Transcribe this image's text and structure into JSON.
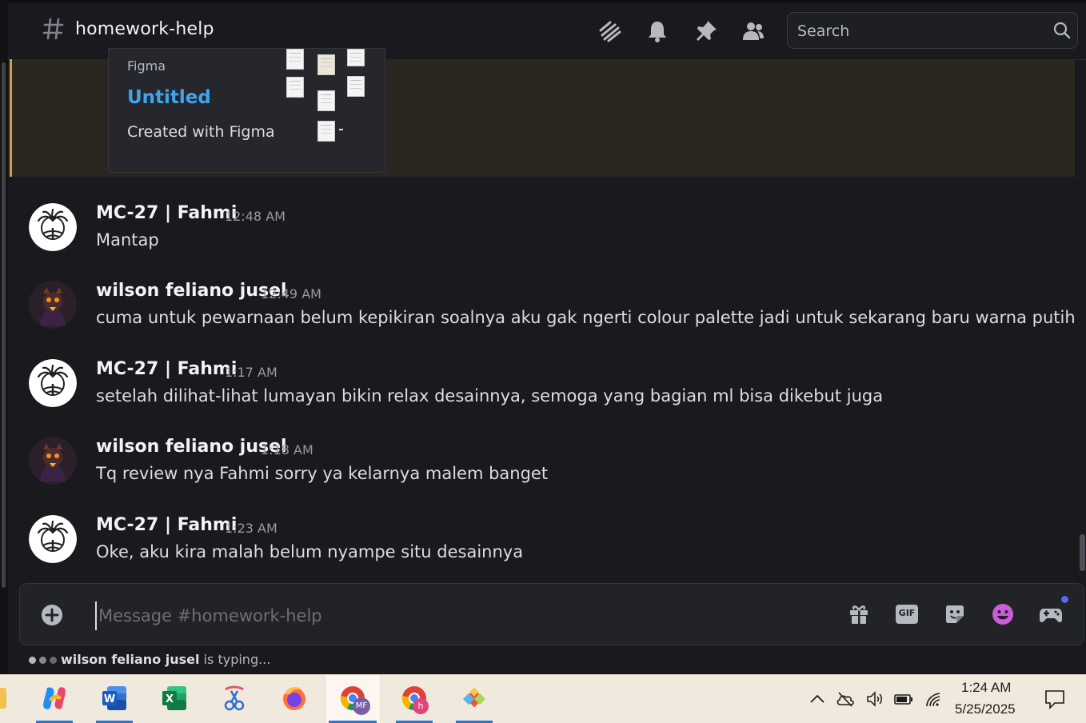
{
  "header": {
    "channel_name": "homework-help",
    "icons": [
      "threads-icon",
      "bell-icon",
      "pin-icon",
      "members-icon"
    ],
    "search_placeholder": "Search"
  },
  "embed": {
    "provider": "Figma",
    "title": "Untitled",
    "description": "Created with Figma",
    "border_color": "#c8a050",
    "title_color": "#3fa5ed"
  },
  "messages": [
    {
      "author": "MC-27 | Fahmi",
      "time": "12:48 AM",
      "text": "Mantap",
      "avatar": "palm-tree-logo"
    },
    {
      "author": "wilson feliano jusel",
      "time": "12:49 AM",
      "text": "cuma untuk pewarnaan belum kepikiran soalnya aku gak ngerti colour palette jadi untuk sekarang baru warna putih",
      "avatar": "dark-character"
    },
    {
      "author": "MC-27 | Fahmi",
      "time": "1:17 AM",
      "text": "setelah dilihat-lihat lumayan bikin relax desainnya, semoga yang bagian ml bisa dikebut juga",
      "avatar": "palm-tree-logo"
    },
    {
      "author": "wilson feliano jusel",
      "time": "1:18 AM",
      "text": "Tq review nya Fahmi sorry ya kelarnya malem banget",
      "avatar": "dark-character"
    },
    {
      "author": "MC-27 | Fahmi",
      "time": "1:23 AM",
      "text": "Oke, aku kira malah belum nyampe situ desainnya",
      "avatar": "palm-tree-logo"
    }
  ],
  "composer": {
    "placeholder": "Message #homework-help",
    "icons": [
      "gift-icon",
      "gif-icon",
      "sticker-icon",
      "emoji-icon",
      "activity-icon"
    ],
    "gif_label": "GIF"
  },
  "typing": {
    "user": "wilson feliano jusel",
    "suffix": " is typing..."
  },
  "taskbar": {
    "apps": [
      "copilot",
      "word",
      "excel",
      "snipping-tool",
      "firefox",
      "chrome-profile-mf",
      "chrome-profile-h",
      "git"
    ],
    "active_app": "chrome-profile-mf",
    "chrome_badges": [
      "MF",
      "h"
    ],
    "time": "1:24 AM",
    "date": "5/25/2025"
  }
}
